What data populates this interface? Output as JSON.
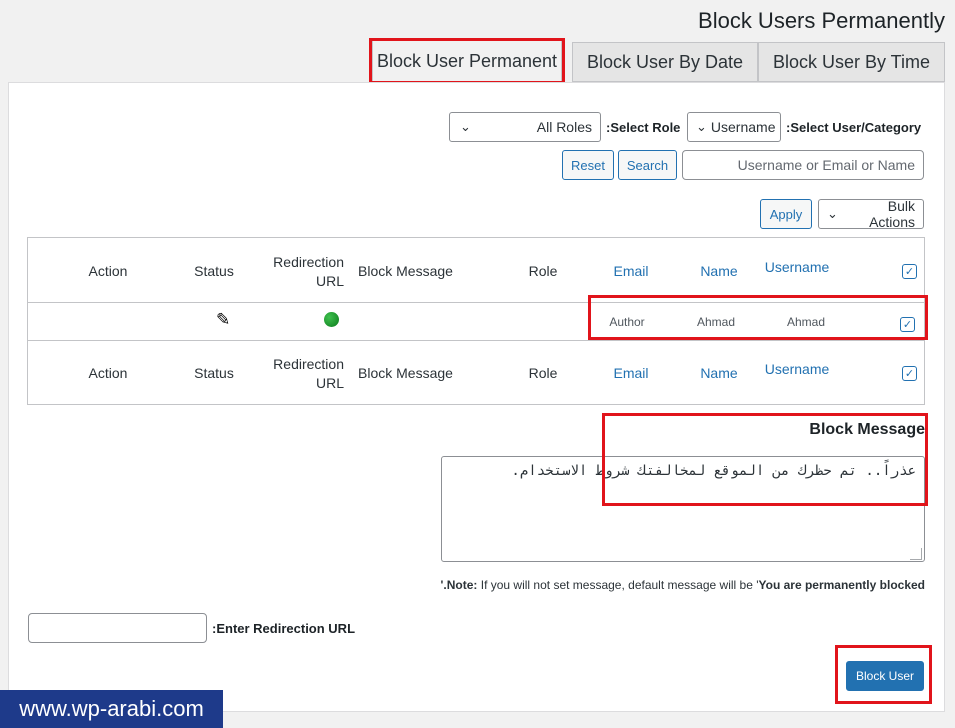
{
  "page": {
    "title": "Block Users Permanently"
  },
  "tabs": [
    {
      "label": "Block User Permanent"
    },
    {
      "label": "Block User By Date"
    },
    {
      "label": "Block User By Time"
    }
  ],
  "filters": {
    "role_label": ":Select Role",
    "role_value": "All Roles",
    "category_label": ":Select User/Category",
    "category_value": "Username",
    "search_placeholder": "Username or Email or Name",
    "reset_label": "Reset",
    "search_label": "Search"
  },
  "bulk": {
    "apply_label": "Apply",
    "actions_value": "Bulk Actions"
  },
  "table": {
    "columns": {
      "action": "Action",
      "status": "Status",
      "redirection_line1": "Redirection",
      "redirection_line2": "URL",
      "block_message": "Block Message",
      "role": "Role",
      "email": "Email",
      "name": "Name",
      "username": "Username"
    },
    "row": {
      "role": "Author",
      "name": "Ahmad",
      "username": "Ahmad"
    }
  },
  "block_message": {
    "heading": "Block Message",
    "value": "عذراً.. تم حظرك من الموقع لمخالفتك شروط الاستخدام."
  },
  "note": {
    "prefix": "'.Note:",
    "text": " If you will not set message, default message will be '",
    "default": "You are permanently blocked"
  },
  "redirect": {
    "label": ":Enter Redirection URL",
    "value": ""
  },
  "actions": {
    "block_user_label": "Block User"
  },
  "watermark": "www.wp-arabi.com",
  "icons": {
    "checkbox": "check-icon",
    "status": "pencil-icon",
    "redirect_status": "green-dot-icon"
  }
}
